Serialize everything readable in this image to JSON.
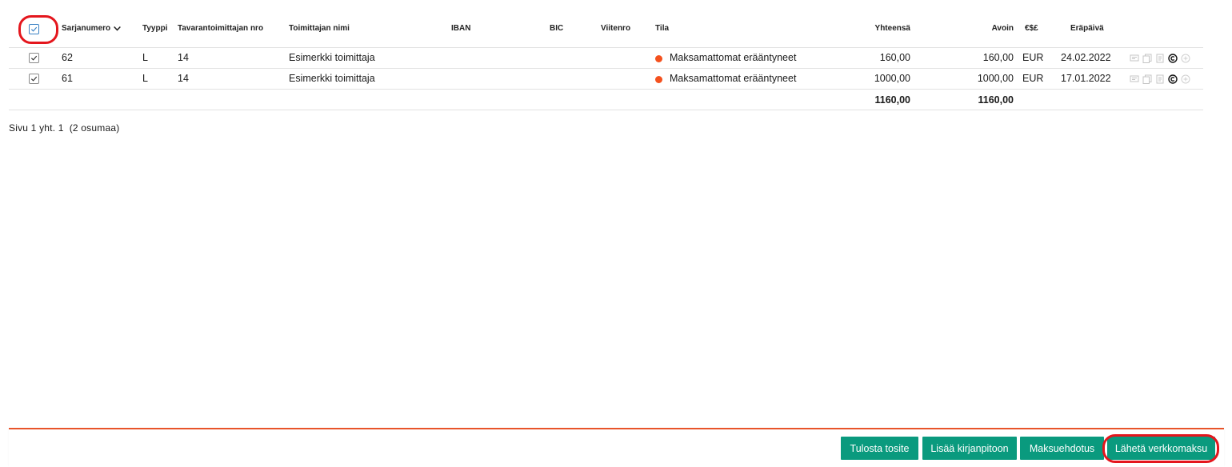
{
  "table": {
    "headers": {
      "serial": "Sarjanumero",
      "type": "Tyyppi",
      "supplier_no": "Tavarantoimittajan nro",
      "supplier_name": "Toimittajan nimi",
      "iban": "IBAN",
      "bic": "BIC",
      "reference": "Viitenro",
      "status": "Tila",
      "total": "Yhteensä",
      "open": "Avoin",
      "currency": "€$£",
      "due_date": "Eräpäivä"
    },
    "rows": [
      {
        "serial": "62",
        "type": "L",
        "supplier_no": "14",
        "supplier_name": "Esimerkki toimittaja",
        "iban": "",
        "bic": "",
        "reference": "",
        "status": "Maksamattomat erääntyneet",
        "total": "160,00",
        "open": "160,00",
        "currency": "EUR",
        "due_date": "24.02.2022",
        "selected": true
      },
      {
        "serial": "61",
        "type": "L",
        "supplier_no": "14",
        "supplier_name": "Esimerkki toimittaja",
        "iban": "",
        "bic": "",
        "reference": "",
        "status": "Maksamattomat erääntyneet",
        "total": "1000,00",
        "open": "1000,00",
        "currency": "EUR",
        "due_date": "17.01.2022",
        "selected": true
      }
    ],
    "totals": {
      "total": "1160,00",
      "open": "1160,00"
    },
    "select_all_checked": true,
    "sort_icon": "chevron-down-icon",
    "row_action_icons": [
      "comment-icon",
      "copy-icon",
      "document-icon",
      "copyright-icon",
      "plus-circle-icon"
    ]
  },
  "pagination": {
    "text": "Sivu 1 yht. 1  (2 osumaa)"
  },
  "footer": {
    "buttons": {
      "print": "Tulosta tosite",
      "add_ledger": "Lisää kirjanpitoon",
      "payment_proposal": "Maksuehdotus",
      "send_payment": "Lähetä verkkomaksu"
    }
  },
  "colors": {
    "status_dot": "#f4511e",
    "button": "#0a9a7e",
    "separator": "#e8542a",
    "highlight": "#e4161d",
    "checkbox_accent": "#3b82c4"
  }
}
